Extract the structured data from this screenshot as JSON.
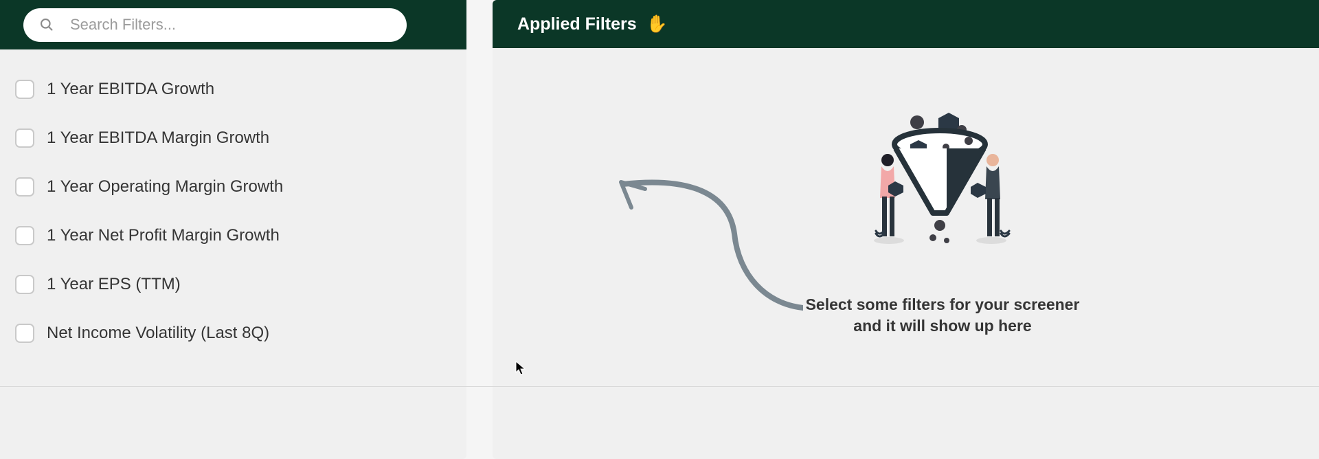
{
  "search": {
    "placeholder": "Search Filters..."
  },
  "filters": {
    "items": [
      {
        "label": "1 Year EBITDA Growth"
      },
      {
        "label": "1 Year EBITDA Margin Growth"
      },
      {
        "label": "1 Year Operating Margin Growth"
      },
      {
        "label": "1 Year Net Profit Margin Growth"
      },
      {
        "label": "1 Year EPS (TTM)"
      },
      {
        "label": "Net Income Volatility (Last 8Q)"
      }
    ]
  },
  "applied": {
    "title": "Applied Filters",
    "icon": "✋",
    "empty_line1": "Select some filters for your screener",
    "empty_line2": "and it will show up here"
  },
  "icons": {
    "search": "search-icon"
  },
  "colors": {
    "header_bg": "#0b3727",
    "panel_bg": "#f0f0f0",
    "text_primary": "#353535",
    "checkbox_border": "#c9c9c9"
  }
}
